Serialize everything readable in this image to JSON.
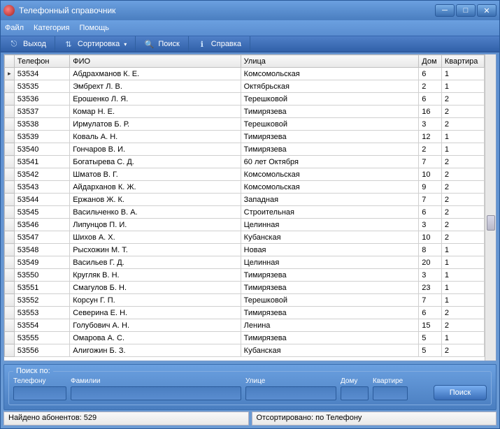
{
  "window": {
    "title": "Телефонный справочник"
  },
  "menu": {
    "file": "Файл",
    "category": "Категория",
    "help": "Помощь"
  },
  "toolbar": {
    "exit": "Выход",
    "sort": "Сортировка",
    "search": "Поиск",
    "about": "Справка"
  },
  "columns": {
    "phone": "Телефон",
    "name": "ФИО",
    "street": "Улица",
    "house": "Дом",
    "apt": "Квартира"
  },
  "rows": [
    {
      "phone": "53534",
      "name": "Абдрахманов К. Е.",
      "street": "Комсомольская",
      "house": "6",
      "apt": "1"
    },
    {
      "phone": "53535",
      "name": "Эмбрехт Л. В.",
      "street": "Октябрьская",
      "house": "2",
      "apt": "1"
    },
    {
      "phone": "53536",
      "name": "Ерошенко Л. Я.",
      "street": "Терешковой",
      "house": "6",
      "apt": "2"
    },
    {
      "phone": "53537",
      "name": "Комар Н. Е.",
      "street": "Тимирязева",
      "house": "16",
      "apt": "2"
    },
    {
      "phone": "53538",
      "name": "Ирмулатов Б. Р.",
      "street": "Терешковой",
      "house": "3",
      "apt": "2"
    },
    {
      "phone": "53539",
      "name": "Коваль А. Н.",
      "street": "Тимирязева",
      "house": "12",
      "apt": "1"
    },
    {
      "phone": "53540",
      "name": "Гончаров В. И.",
      "street": "Тимирязева",
      "house": "2",
      "apt": "1"
    },
    {
      "phone": "53541",
      "name": "Богатырева С. Д.",
      "street": "60 лет Октября",
      "house": "7",
      "apt": "2"
    },
    {
      "phone": "53542",
      "name": "Шматов В. Г.",
      "street": "Комсомольская",
      "house": "10",
      "apt": "2"
    },
    {
      "phone": "53543",
      "name": "Айдарханов К. Ж.",
      "street": "Комсомольская",
      "house": "9",
      "apt": "2"
    },
    {
      "phone": "53544",
      "name": "Ержанов Ж. К.",
      "street": "Западная",
      "house": "7",
      "apt": "2"
    },
    {
      "phone": "53545",
      "name": "Васильченко В. А.",
      "street": "Строительная",
      "house": "6",
      "apt": "2"
    },
    {
      "phone": "53546",
      "name": "Липунцов П. И.",
      "street": "Целинная",
      "house": "3",
      "apt": "2"
    },
    {
      "phone": "53547",
      "name": "Шихов А. Х.",
      "street": "Кубанская",
      "house": "10",
      "apt": "2"
    },
    {
      "phone": "53548",
      "name": "Рысхожин М. Т.",
      "street": "Новая",
      "house": "8",
      "apt": "1"
    },
    {
      "phone": "53549",
      "name": "Васильев Г. Д.",
      "street": "Целинная",
      "house": "20",
      "apt": "1"
    },
    {
      "phone": "53550",
      "name": "Кругляк В. Н.",
      "street": "Тимирязева",
      "house": "3",
      "apt": "1"
    },
    {
      "phone": "53551",
      "name": "Смагулов Б. Н.",
      "street": "Тимирязева",
      "house": "23",
      "apt": "1"
    },
    {
      "phone": "53552",
      "name": "Корсун Г. П.",
      "street": "Терешковой",
      "house": "7",
      "apt": "1"
    },
    {
      "phone": "53553",
      "name": "Северина Е. Н.",
      "street": "Тимирязева",
      "house": "6",
      "apt": "2"
    },
    {
      "phone": "53554",
      "name": "Голубович А. Н.",
      "street": "Ленина",
      "house": "15",
      "apt": "2"
    },
    {
      "phone": "53555",
      "name": "Омарова А. С.",
      "street": "Тимирязева",
      "house": "5",
      "apt": "1"
    },
    {
      "phone": "53556",
      "name": "Алигожин Б. З.",
      "street": "Кубанская",
      "house": "5",
      "apt": "2"
    }
  ],
  "search": {
    "legend": "Поиск по:",
    "phone_label": "Телефону",
    "name_label": "Фамилии",
    "street_label": "Улице",
    "house_label": "Дому",
    "apt_label": "Квартире",
    "button": "Поиск"
  },
  "status": {
    "found": "Найдено абонентов: 529",
    "sorted": "Отсортировано: по Телефону"
  }
}
